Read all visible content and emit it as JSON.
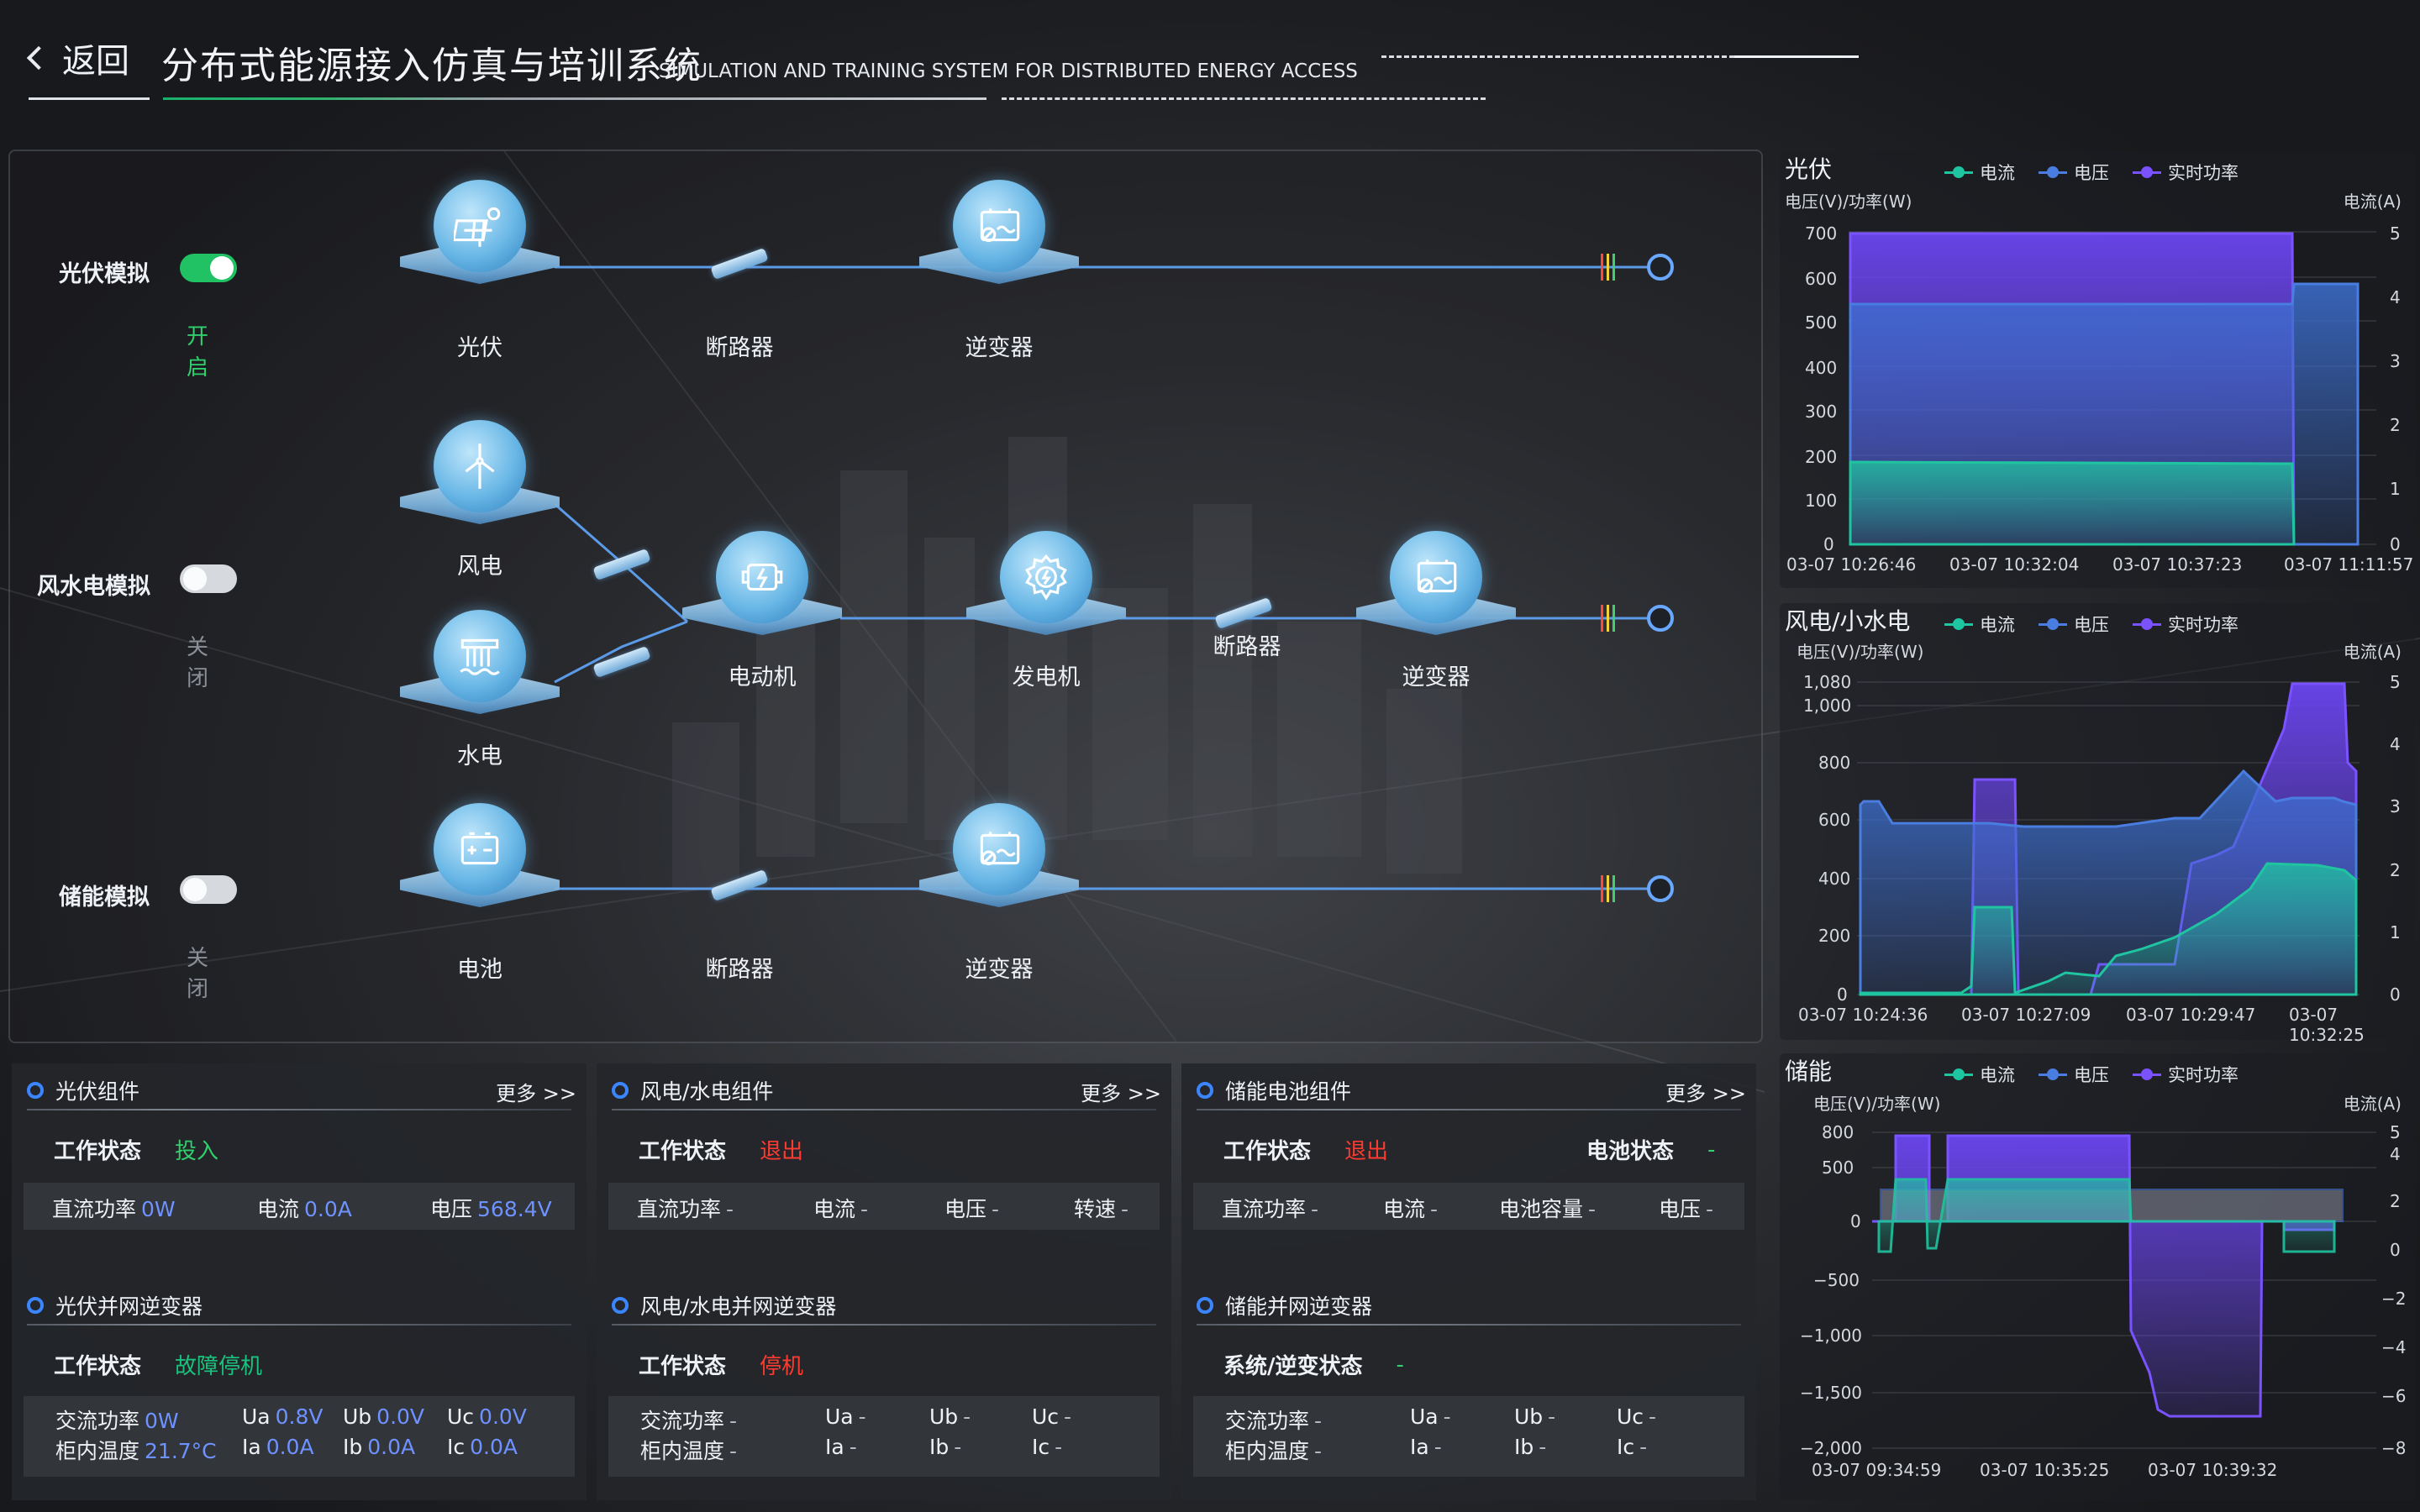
{
  "header": {
    "back_label": "返回",
    "title": "分布式能源接入仿真与培训系统",
    "subtitle": "SIMULATION AND TRAINING SYSTEM FOR DISTRIBUTED ENERGY ACCESS"
  },
  "modes": {
    "pv": {
      "label": "光伏模拟",
      "state": "开启",
      "on": true
    },
    "wind": {
      "label": "风水电模拟",
      "state": "关闭",
      "on": false
    },
    "storage": {
      "label": "储能模拟",
      "state": "关闭",
      "on": false
    }
  },
  "nodes": {
    "pv": "光伏",
    "breaker1": "断路器",
    "inverter1": "逆变器",
    "wind": "风电",
    "hydro": "水电",
    "motor": "电动机",
    "generator": "发电机",
    "breaker2": "断路器",
    "inverter2": "逆变器",
    "battery": "电池",
    "breaker3": "断路器",
    "inverter3": "逆变器"
  },
  "icons": [
    "solar-panel-icon",
    "inverter-icon",
    "wind-turbine-icon",
    "hydro-icon",
    "motor-icon",
    "generator-icon",
    "battery-icon"
  ],
  "colors": {
    "current": "#1fc4a0",
    "voltage": "#4a7de0",
    "power": "#7a52ff",
    "on": "#21c264",
    "fault": "#ff3b30",
    "value": "#6e92ff"
  },
  "legend": {
    "current": "电流",
    "voltage": "电压",
    "power": "实时功率"
  },
  "charts": {
    "pv": {
      "title": "光伏",
      "left_unit": "电压(V)/功率(W)",
      "right_unit": "电流(A)",
      "left_ticks": [
        "700",
        "600",
        "500",
        "400",
        "300",
        "200",
        "100",
        "0"
      ],
      "right_ticks": [
        "5",
        "4",
        "3",
        "2",
        "1",
        "0"
      ],
      "x_ticks": [
        "03-07 10:26:46",
        "03-07 10:32:04",
        "03-07 10:37:23",
        "03-07 11:11:57"
      ]
    },
    "wind": {
      "title": "风电/小水电",
      "left_unit": "电压(V)/功率(W)",
      "right_unit": "电流(A)",
      "left_ticks": [
        "1,080",
        "1,000",
        "800",
        "600",
        "400",
        "200",
        "0"
      ],
      "right_ticks": [
        "5",
        "4",
        "3",
        "2",
        "1",
        "0"
      ],
      "x_ticks": [
        "03-07 10:24:36",
        "03-07 10:27:09",
        "03-07 10:29:47",
        "03-07 10:32:25"
      ]
    },
    "storage": {
      "title": "储能",
      "left_unit": "电压(V)/功率(W)",
      "right_unit": "电流(A)",
      "left_ticks": [
        "800",
        "500",
        "0",
        "−500",
        "−1,000",
        "−1,500",
        "−2,000"
      ],
      "right_ticks": [
        "5",
        "4",
        "2",
        "0",
        "−2",
        "−4",
        "−6",
        "−8"
      ],
      "x_ticks": [
        "03-07 09:34:59",
        "03-07 10:35:25",
        "03-07 10:39:32"
      ]
    }
  },
  "chart_data": [
    {
      "type": "area",
      "title": "光伏",
      "x": [
        "03-07 10:26:46",
        "03-07 10:32:04",
        "03-07 10:37:23",
        "03-07 11:11:57"
      ],
      "ylabel": "电压(V)/功率(W)",
      "ylabel_right": "电流(A)",
      "ylim": [
        0,
        700
      ],
      "ylim_right": [
        0,
        5
      ],
      "series": [
        {
          "name": "电流",
          "values": [
            1.3,
            1.3,
            1.3,
            0
          ]
        },
        {
          "name": "电压",
          "values": [
            540,
            540,
            540,
            575
          ]
        },
        {
          "name": "实时功率",
          "values": [
            690,
            690,
            690,
            0
          ]
        }
      ]
    },
    {
      "type": "area",
      "title": "风电/小水电",
      "x": [
        "03-07 10:24:36",
        "03-07 10:27:09",
        "03-07 10:29:47",
        "03-07 10:32:25"
      ],
      "ylabel": "电压(V)/功率(W)",
      "ylabel_right": "电流(A)",
      "ylim": [
        0,
        1080
      ],
      "ylim_right": [
        0,
        5
      ],
      "series": [
        {
          "name": "电流",
          "values": [
            0,
            0.2,
            1.1,
            2.1
          ]
        },
        {
          "name": "电压",
          "values": [
            650,
            540,
            540,
            560
          ]
        },
        {
          "name": "实时功率",
          "values": [
            0,
            0,
            300,
            1080
          ]
        }
      ]
    },
    {
      "type": "area",
      "title": "储能",
      "x": [
        "03-07 09:34:59",
        "03-07 10:35:25",
        "03-07 10:39:32"
      ],
      "ylabel": "电压(V)/功率(W)",
      "ylabel_right": "电流(A)",
      "ylim": [
        -2000,
        800
      ],
      "ylim_right": [
        -8,
        5
      ],
      "series": [
        {
          "name": "电流",
          "values": [
            0.6,
            0.6,
            -1.1
          ]
        },
        {
          "name": "电压",
          "values": [
            300,
            300,
            0
          ]
        },
        {
          "name": "实时功率",
          "values": [
            750,
            750,
            -1700
          ]
        }
      ]
    }
  ],
  "panels": {
    "pv": {
      "title": "光伏组件",
      "more": "更多 >>",
      "status_label": "工作状态",
      "status_value": "投入",
      "fields": [
        {
          "k": "直流功率",
          "v": "0W"
        },
        {
          "k": "电流",
          "v": "0.0A"
        },
        {
          "k": "电压",
          "v": "568.4V"
        }
      ],
      "inverter_title": "光伏并网逆变器",
      "inv_status_label": "工作状态",
      "inv_status_value": "故障停机",
      "inv_fields": [
        {
          "k": "交流功率",
          "v": "0W"
        },
        {
          "k": "Ua",
          "v": "0.8V"
        },
        {
          "k": "Ub",
          "v": "0.0V"
        },
        {
          "k": "Uc",
          "v": "0.0V"
        },
        {
          "k": "柜内温度",
          "v": "21.7°C"
        },
        {
          "k": "Ia",
          "v": "0.0A"
        },
        {
          "k": "Ib",
          "v": "0.0A"
        },
        {
          "k": "Ic",
          "v": "0.0A"
        }
      ]
    },
    "wind": {
      "title": "风电/水电组件",
      "more": "更多 >>",
      "status_label": "工作状态",
      "status_value": "退出",
      "fields": [
        {
          "k": "直流功率",
          "v": "-"
        },
        {
          "k": "电流",
          "v": "-"
        },
        {
          "k": "电压",
          "v": "-"
        },
        {
          "k": "转速",
          "v": "-"
        }
      ],
      "inverter_title": "风电/水电并网逆变器",
      "inv_status_label": "工作状态",
      "inv_status_value": "停机",
      "inv_fields": [
        {
          "k": "交流功率",
          "v": "-"
        },
        {
          "k": "Ua",
          "v": "-"
        },
        {
          "k": "Ub",
          "v": "-"
        },
        {
          "k": "Uc",
          "v": "-"
        },
        {
          "k": "柜内温度",
          "v": "-"
        },
        {
          "k": "Ia",
          "v": "-"
        },
        {
          "k": "Ib",
          "v": "-"
        },
        {
          "k": "Ic",
          "v": "-"
        }
      ]
    },
    "storage": {
      "title": "储能电池组件",
      "more": "更多 >>",
      "status_label": "工作状态",
      "status_value": "退出",
      "battery_label": "电池状态",
      "battery_value": "-",
      "fields": [
        {
          "k": "直流功率",
          "v": "-"
        },
        {
          "k": "电流",
          "v": "-"
        },
        {
          "k": "电池容量",
          "v": "-"
        },
        {
          "k": "电压",
          "v": "-"
        }
      ],
      "inverter_title": "储能并网逆变器",
      "inv_status_label": "系统/逆变状态",
      "inv_status_value": "-",
      "inv_fields": [
        {
          "k": "交流功率",
          "v": "-"
        },
        {
          "k": "Ua",
          "v": "-"
        },
        {
          "k": "Ub",
          "v": "-"
        },
        {
          "k": "Uc",
          "v": "-"
        },
        {
          "k": "柜内温度",
          "v": "-"
        },
        {
          "k": "Ia",
          "v": "-"
        },
        {
          "k": "Ib",
          "v": "-"
        },
        {
          "k": "Ic",
          "v": "-"
        }
      ]
    }
  }
}
